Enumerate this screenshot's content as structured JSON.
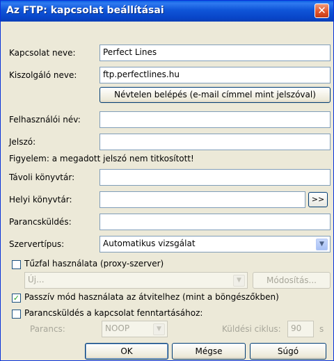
{
  "window": {
    "title": "Az FTP: kapcsolat beállításai",
    "close_glyph": "✕"
  },
  "fields": {
    "connection_name": {
      "label": "Kapcsolat neve:",
      "value": "Perfect Lines"
    },
    "server_name": {
      "label": "Kiszolgáló neve:",
      "value": "ftp.perfectlines.hu"
    },
    "anonymous_button": "Névtelen belépés (e-mail címmel mint jelszóval)",
    "username": {
      "label": "Felhasználói név:",
      "value": ""
    },
    "password": {
      "label": "Jelszó:",
      "value": ""
    },
    "warning": "Figyelem: a megadott jelszó nem titkosított!",
    "remote_dir": {
      "label": "Távoli könyvtár:",
      "value": ""
    },
    "local_dir": {
      "label": "Helyi könyvtár:",
      "value": "",
      "browse": ">>"
    },
    "command": {
      "label": "Parancsküldés:",
      "value": ""
    },
    "server_type": {
      "label": "Szervertípus:",
      "value": "Automatikus vizsgálat"
    }
  },
  "firewall": {
    "checkbox_label": "Tűzfal használata (proxy-szerver)",
    "checked": false,
    "select_value": "Új...",
    "modify_button": "Módosítás..."
  },
  "passive": {
    "label": "Passzív mód használata az átvitelhez (mint a böngészőkben)",
    "checked": true
  },
  "keepalive": {
    "label": "Parancsküldés a kapcsolat fenntartásához:",
    "checked": false,
    "command_label": "Parancs:",
    "command_value": "NOOP",
    "cycle_label": "Küldési ciklus:",
    "cycle_value": "90",
    "unit": "s"
  },
  "buttons": {
    "ok": "OK",
    "cancel": "Mégse",
    "help": "Súgó"
  },
  "colors": {
    "titlebar": "#0a5fe3",
    "dialog_bg": "#ece9d8",
    "close": "#e2552c",
    "field_border": "#7f9db9"
  }
}
